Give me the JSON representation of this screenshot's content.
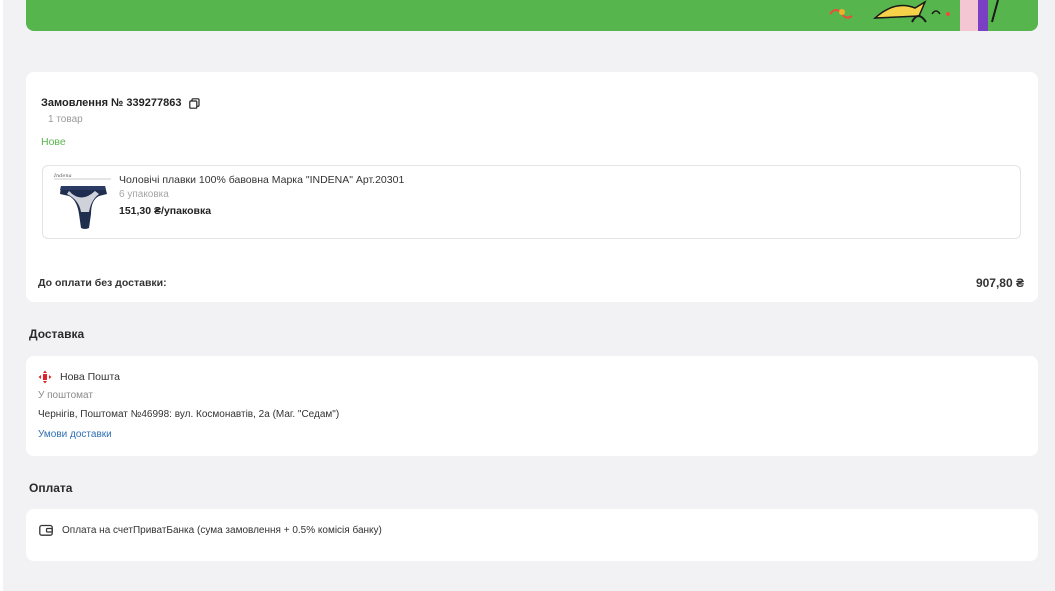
{
  "order": {
    "title": "Замовлення № 339277863",
    "item_count": "1 товар",
    "status": "Нове",
    "product": {
      "name": "Чоловічі плавки 100% бавовна Марка \"INDENA\" Арт.20301",
      "package": "6 упаковка",
      "price": "151,30 ₴/упаковка"
    },
    "total_label": "До оплати без доставки:",
    "total_value": "907,80 ₴"
  },
  "delivery": {
    "section_title": "Доставка",
    "carrier": "Нова Пошта",
    "method": "У поштомат",
    "address": "Чернігів, Поштомат №46998: вул. Космонавтів, 2а (Маг. \"Седам\")",
    "terms_link": "Умови доставки"
  },
  "payment": {
    "section_title": "Оплата",
    "method": "Оплата на счетПриватБанка (сума замовлення + 0.5% комісія банку)"
  },
  "colors": {
    "banner_green": "#57b54d",
    "status_green": "#57b54d",
    "link_blue": "#2f6fb3",
    "novaposhta_red": "#e2222b"
  },
  "icons": {
    "copy": "copy-icon",
    "carrier": "nova-poshta-logo-icon",
    "payment": "wallet-icon"
  }
}
